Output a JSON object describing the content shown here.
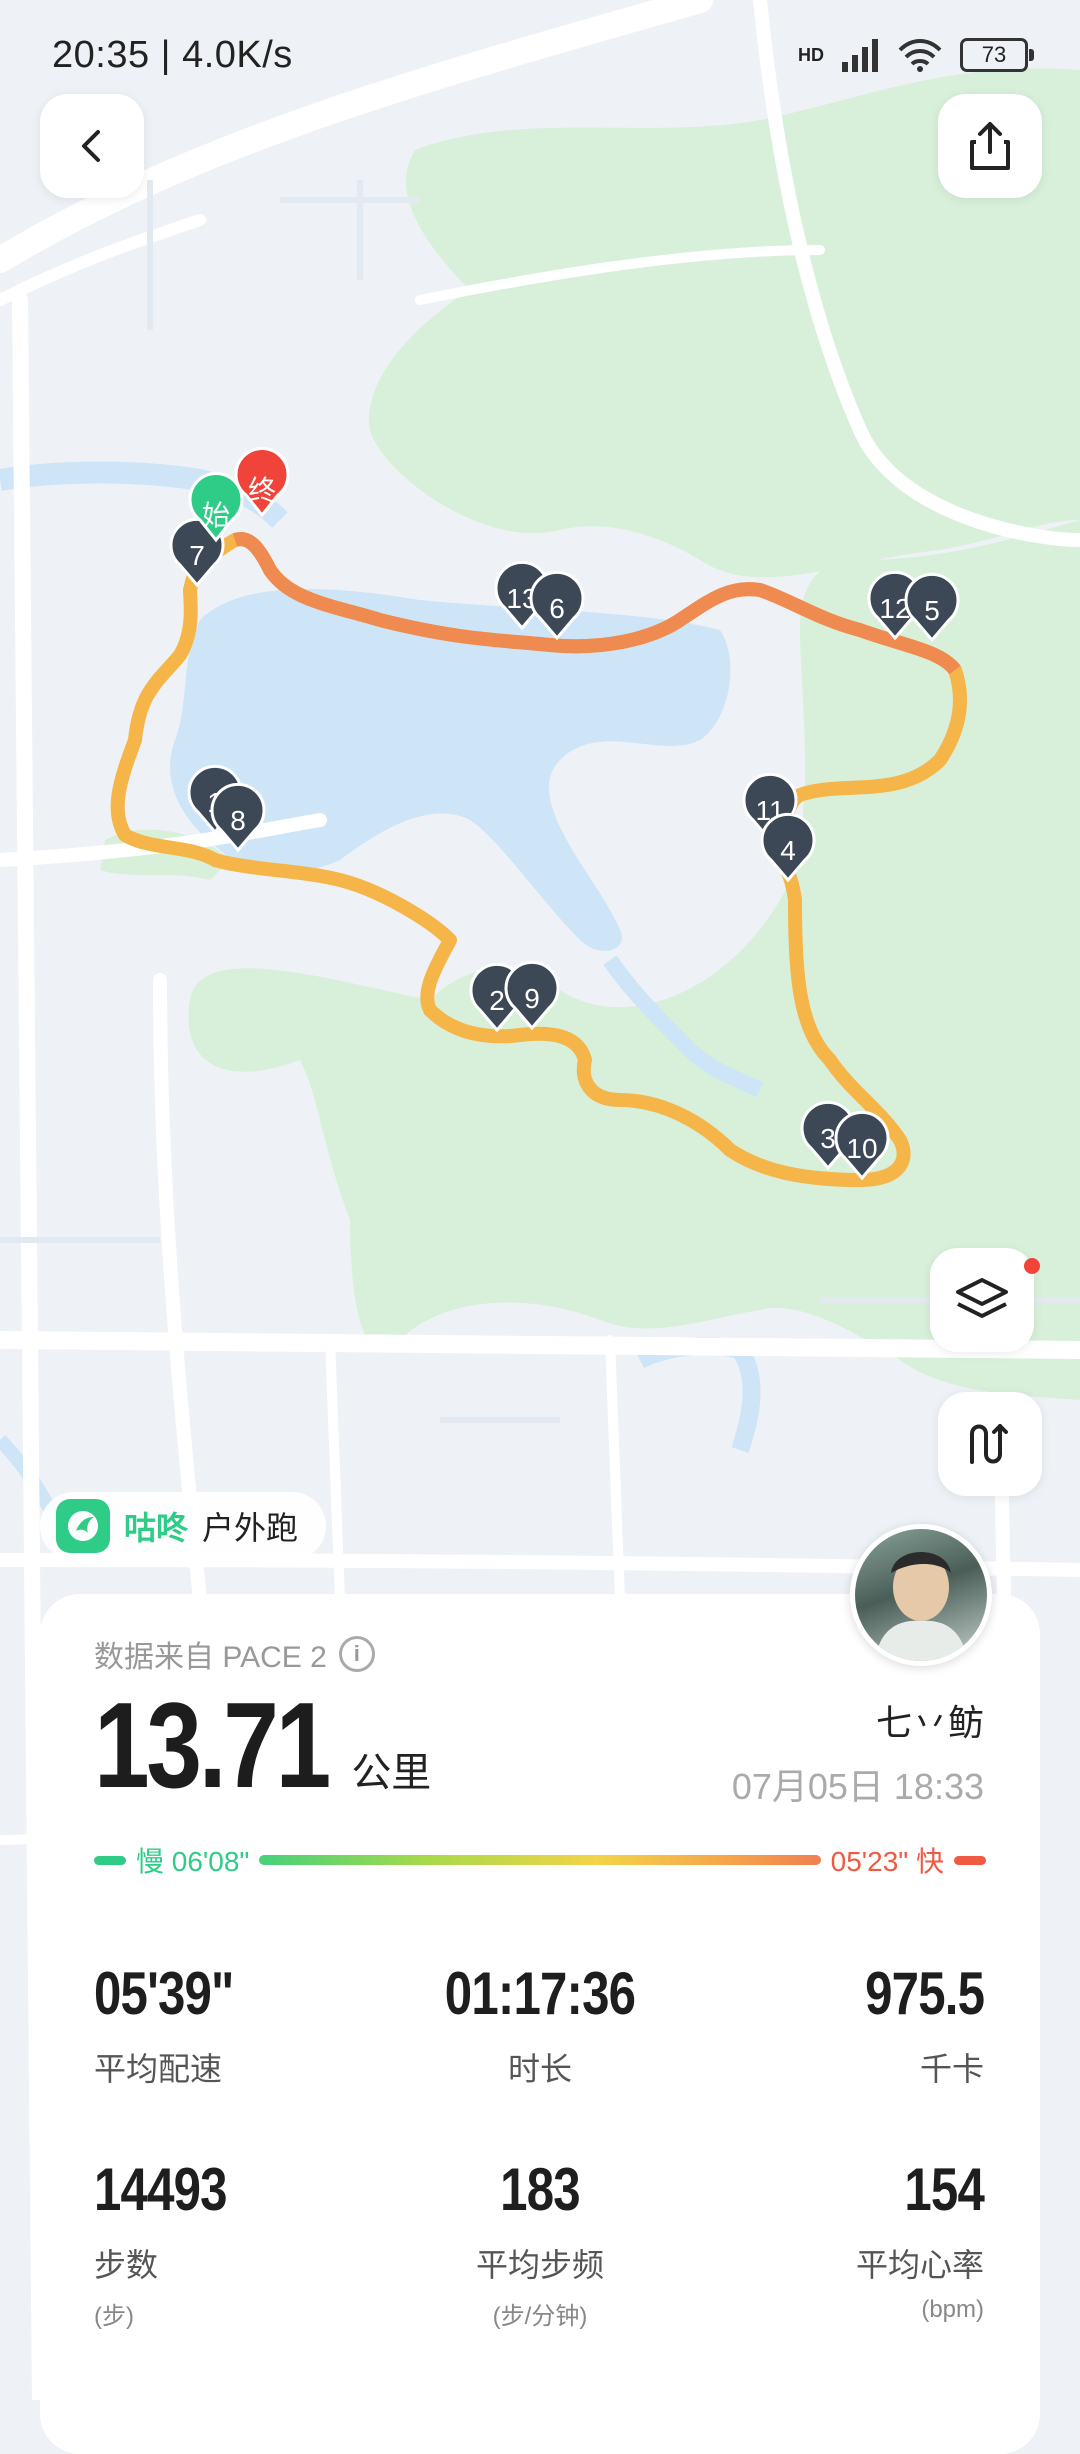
{
  "status_bar": {
    "time_speed": "20:35 | 4.0K/s",
    "network_badge": "HD",
    "battery": "73"
  },
  "map": {
    "start_label": "始",
    "end_label": "终",
    "km_markers": [
      "1",
      "2",
      "3",
      "4",
      "5",
      "6",
      "7",
      "8",
      "9",
      "10",
      "11",
      "12",
      "13"
    ]
  },
  "brand": {
    "name": "咕咚",
    "mode": "户外跑"
  },
  "summary": {
    "source": "数据来自 PACE 2",
    "distance": "13.71",
    "distance_unit": "公里",
    "username": "七丷鲂",
    "datetime": "07月05日 18:33",
    "pace_slow": "慢 06'08\"",
    "pace_fast": "05'23\" 快"
  },
  "stats": [
    {
      "value": "05'39\"",
      "label": "平均配速",
      "sub": ""
    },
    {
      "value": "01:17:36",
      "label": "时长",
      "sub": ""
    },
    {
      "value": "975.5",
      "label": "千卡",
      "sub": ""
    },
    {
      "value": "14493",
      "label": "步数",
      "sub": "(步)"
    },
    {
      "value": "183",
      "label": "平均步频",
      "sub": "(步/分钟)"
    },
    {
      "value": "154",
      "label": "平均心率",
      "sub": "(bpm)"
    }
  ],
  "icons": {
    "back": "chevron-left-icon",
    "share": "share-icon",
    "layers": "layers-icon",
    "route": "route-icon"
  }
}
